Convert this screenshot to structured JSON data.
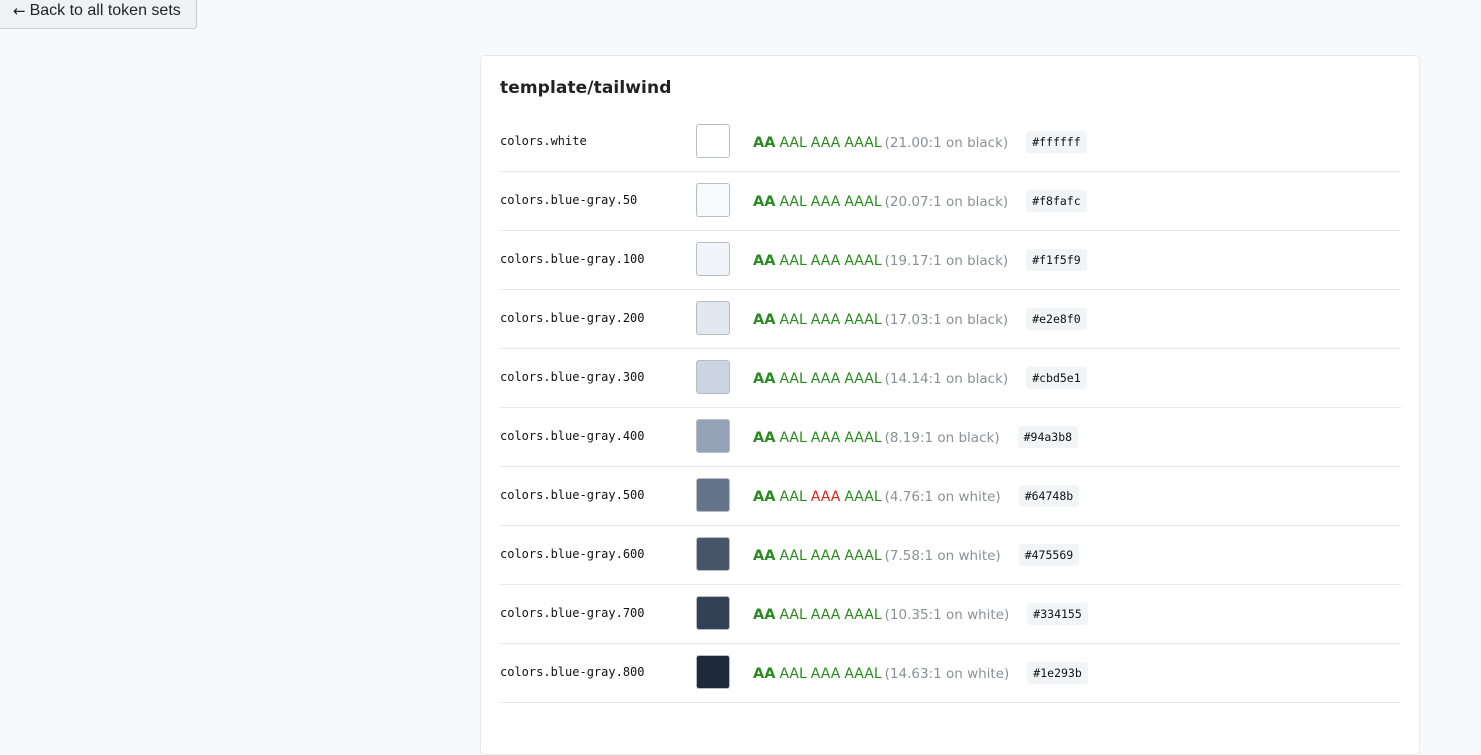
{
  "nav": {
    "back_arrow": "←",
    "back_label": "Back to all token sets"
  },
  "card": {
    "title": "template/tailwind"
  },
  "level_labels": {
    "aa": "AA",
    "aal": "AAL",
    "aaa": "AAA",
    "aaal": "AAAL"
  },
  "status_colors": {
    "pass": "#2a8a1f",
    "fail": "#d9241c"
  },
  "tokens": [
    {
      "name": "colors.white",
      "swatch": "#ffffff",
      "ratio": "(21.00:1 on black)",
      "hex": "#ffffff",
      "aa": "pass",
      "aal": "pass",
      "aaa": "pass",
      "aaal": "pass"
    },
    {
      "name": "colors.blue-gray.50",
      "swatch": "#f8fafc",
      "ratio": "(20.07:1 on black)",
      "hex": "#f8fafc",
      "aa": "pass",
      "aal": "pass",
      "aaa": "pass",
      "aaal": "pass"
    },
    {
      "name": "colors.blue-gray.100",
      "swatch": "#f1f5f9",
      "ratio": "(19.17:1 on black)",
      "hex": "#f1f5f9",
      "aa": "pass",
      "aal": "pass",
      "aaa": "pass",
      "aaal": "pass"
    },
    {
      "name": "colors.blue-gray.200",
      "swatch": "#e2e8f0",
      "ratio": "(17.03:1 on black)",
      "hex": "#e2e8f0",
      "aa": "pass",
      "aal": "pass",
      "aaa": "pass",
      "aaal": "pass"
    },
    {
      "name": "colors.blue-gray.300",
      "swatch": "#cbd5e1",
      "ratio": "(14.14:1 on black)",
      "hex": "#cbd5e1",
      "aa": "pass",
      "aal": "pass",
      "aaa": "pass",
      "aaal": "pass"
    },
    {
      "name": "colors.blue-gray.400",
      "swatch": "#94a3b8",
      "ratio": "(8.19:1 on black)",
      "hex": "#94a3b8",
      "aa": "pass",
      "aal": "pass",
      "aaa": "pass",
      "aaal": "pass"
    },
    {
      "name": "colors.blue-gray.500",
      "swatch": "#64748b",
      "ratio": "(4.76:1 on white)",
      "hex": "#64748b",
      "aa": "pass",
      "aal": "pass",
      "aaa": "fail",
      "aaal": "pass"
    },
    {
      "name": "colors.blue-gray.600",
      "swatch": "#475569",
      "ratio": "(7.58:1 on white)",
      "hex": "#475569",
      "aa": "pass",
      "aal": "pass",
      "aaa": "pass",
      "aaal": "pass"
    },
    {
      "name": "colors.blue-gray.700",
      "swatch": "#334155",
      "ratio": "(10.35:1 on white)",
      "hex": "#334155",
      "aa": "pass",
      "aal": "pass",
      "aaa": "pass",
      "aaal": "pass"
    },
    {
      "name": "colors.blue-gray.800",
      "swatch": "#1e293b",
      "ratio": "(14.63:1 on white)",
      "hex": "#1e293b",
      "aa": "pass",
      "aal": "pass",
      "aaa": "pass",
      "aaal": "pass"
    }
  ]
}
